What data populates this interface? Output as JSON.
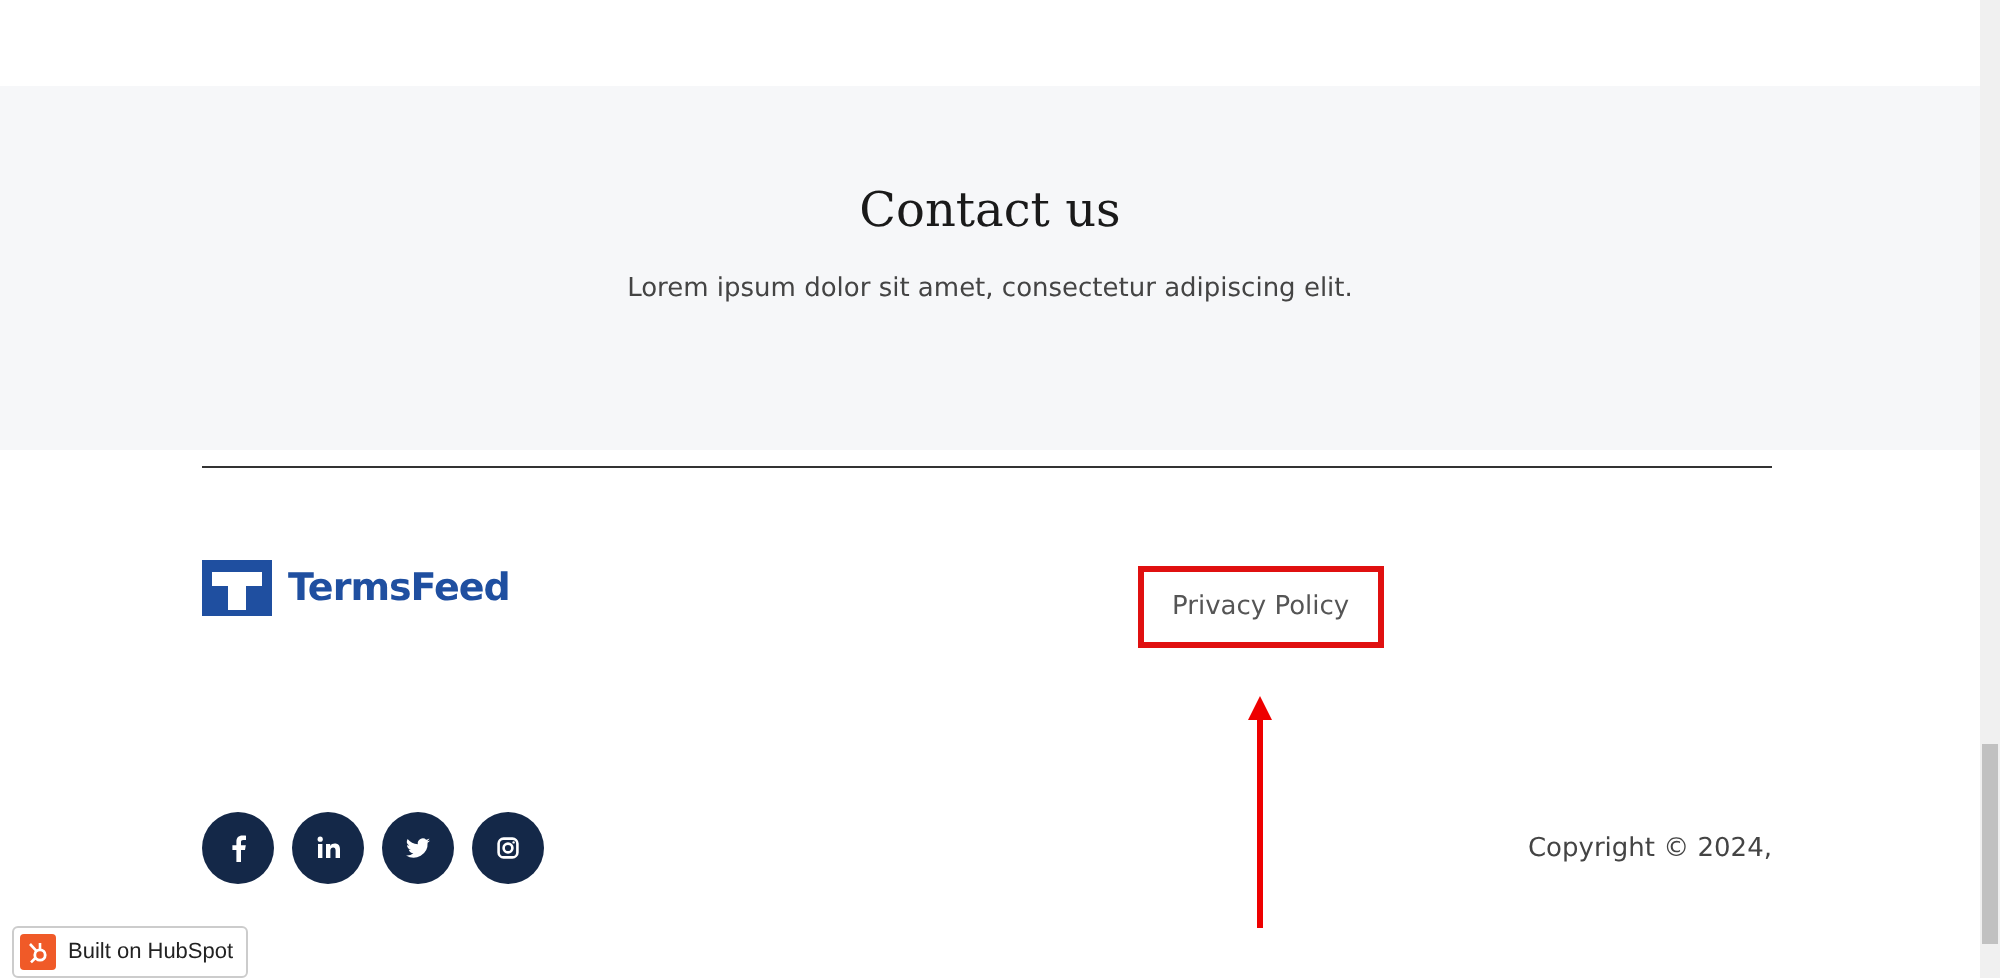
{
  "contact": {
    "title": "Contact us",
    "text": "Lorem ipsum dolor sit amet, consectetur adipiscing elit."
  },
  "footer": {
    "logo": "TermsFeed",
    "links": [
      {
        "label": "Privacy Policy",
        "highlighted": true
      }
    ],
    "social": [
      {
        "kind": "facebook"
      },
      {
        "kind": "linkedin"
      },
      {
        "kind": "twitter"
      },
      {
        "kind": "instagram"
      }
    ],
    "copyright": "Copyright © 2024,"
  },
  "badge": {
    "label": "Built on HubSpot"
  }
}
